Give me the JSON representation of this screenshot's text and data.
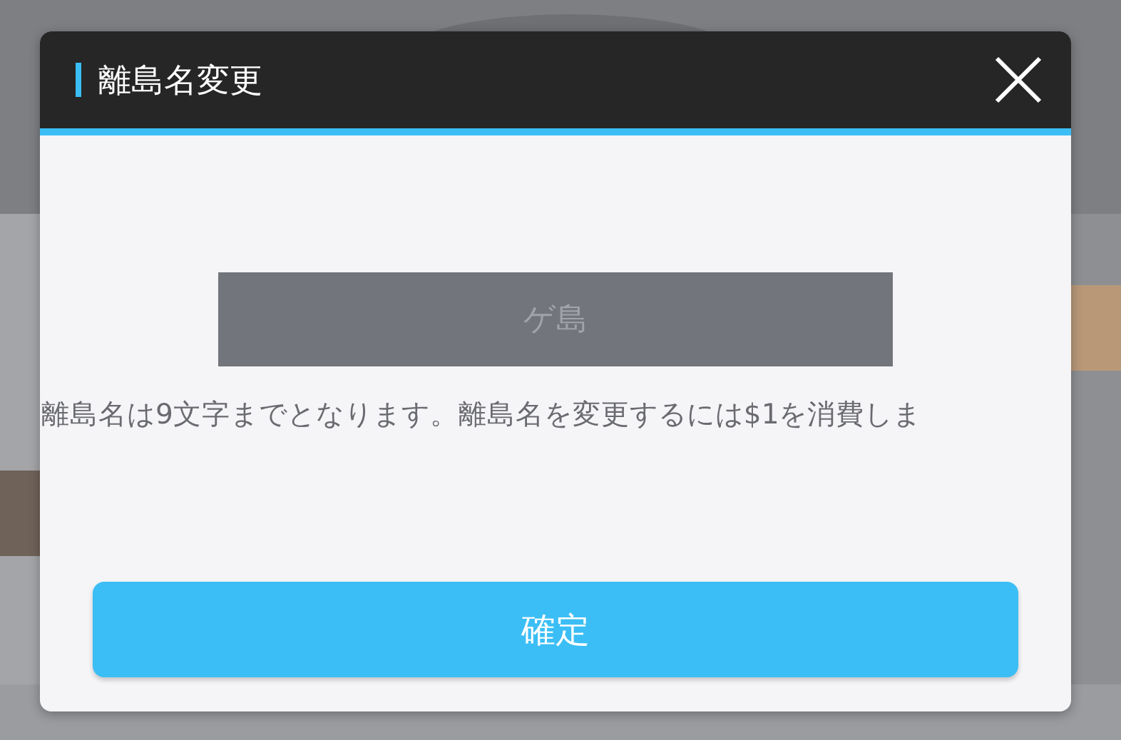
{
  "dialog": {
    "title": "離島名変更",
    "name_field": {
      "value": "ゲ島"
    },
    "note": "離島名は9文字までとなります。離島名を変更するには$1を消費しま",
    "confirm_button": "確定"
  }
}
